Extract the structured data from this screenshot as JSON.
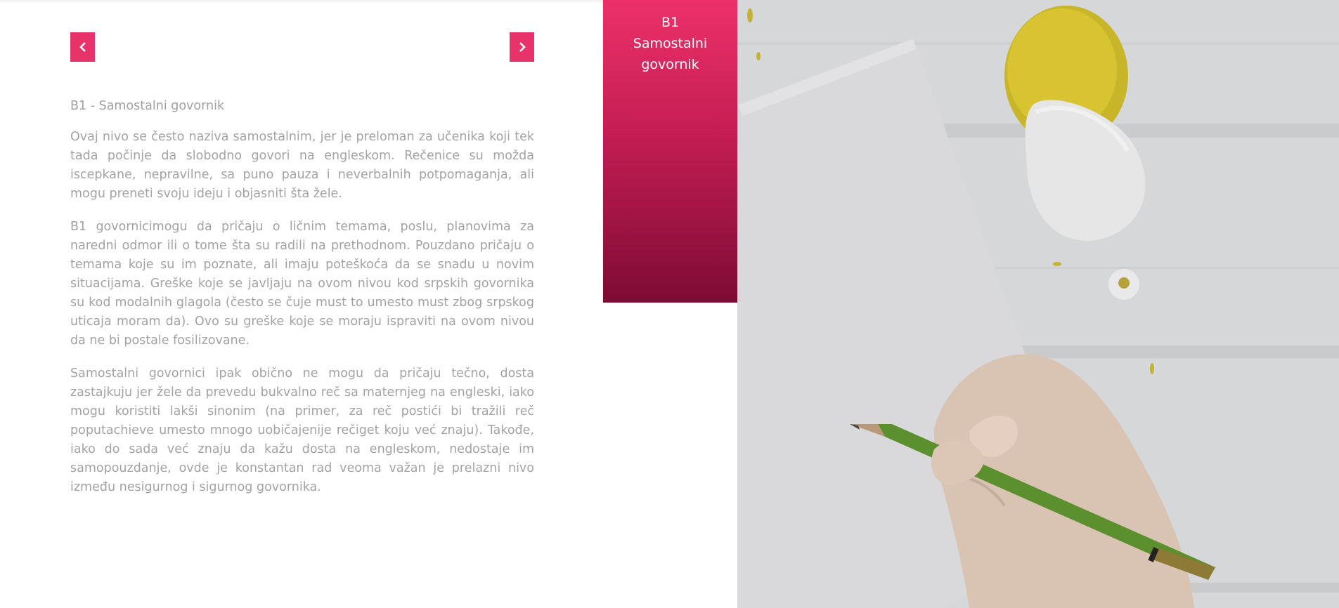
{
  "slider": {
    "prev_label": "Previous",
    "next_label": "Next"
  },
  "level_card": {
    "title_line1": "B1",
    "title_line2": "Samostalni",
    "title_line3": "govornik"
  },
  "article": {
    "heading": "B1 - Samostalni govornik",
    "paragraphs": [
      "Ovaj nivo se često naziva samostalnim, jer je preloman za učenika koji tek tada počinje da slobodno govori na engleskom. Rečenice su možda iscepkane, nepravilne, sa puno pauza i neverbalnih potpomaganja, ali mogu preneti svoju ideju i objasniti šta žele.",
      "B1 govornicimogu da pričaju o ličnim temama, poslu, planovima za naredni odmor ili o tome šta su radili na prethodnom. Pouzdano pričaju o temama koje su im poznate, ali imaju poteškoća da se snadu u novim situacijama. Greške koje se javljaju na ovom nivou kod srpskih govornika su kod modalnih glagola (često se čuje must to umesto must zbog srpskog uticaja moram da). Ovo su greške koje se moraju ispraviti na ovom nivou da ne bi postale fosilizovane.",
      "Samostalni govornici ipak obično ne mogu da pričaju tečno, dosta zastajkuju jer žele da prevedu bukvalno reč sa maternjeg na engleski, iako mogu koristiti lakši sinonim (na primer, za reč postići bi tražili reč poputachieve umesto mnogo uobičajenije rečiget koju već znaju). Takođe, iako do sada već znaju da kažu dosta na engleskom, nedostaje im samopouzdanje, ovde je konstantan rad veoma važan je prelazni nivo između nesigurnog i sigurnog govornika."
    ]
  },
  "colors": {
    "accent": "#e8336a",
    "card_top": "#ec3169",
    "card_bottom": "#7d0b34",
    "body_text": "#a3a3a3"
  },
  "icons": {
    "prev": "chevron-left-icon",
    "next": "chevron-right-icon"
  }
}
